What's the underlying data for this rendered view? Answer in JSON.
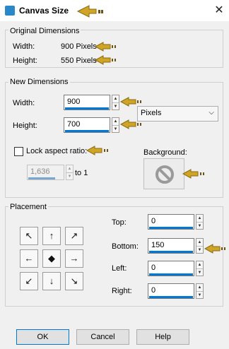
{
  "window": {
    "title": "Canvas Size",
    "close_glyph": "✕"
  },
  "original": {
    "title": "Original Dimensions",
    "width_label": "Width:",
    "width_value": "900 Pixels",
    "height_label": "Height:",
    "height_value": "550 Pixels"
  },
  "new_dimensions": {
    "title": "New Dimensions",
    "width_label": "Width:",
    "width_value": "900",
    "height_label": "Height:",
    "height_value": "700",
    "units_value": "Pixels",
    "lock_label": "Lock aspect ratio:",
    "ratio_value": "1,636",
    "ratio_suffix": "to 1",
    "background_label": "Background:"
  },
  "placement": {
    "title": "Placement",
    "grid_glyphs": [
      "↖",
      "↑",
      "↗",
      "←",
      "◆",
      "→",
      "↙",
      "↓",
      "↘"
    ],
    "top_label": "Top:",
    "top_value": "0",
    "bottom_label": "Bottom:",
    "bottom_value": "150",
    "left_label": "Left:",
    "left_value": "0",
    "right_label": "Right:",
    "right_value": "0"
  },
  "buttons": {
    "ok": "OK",
    "cancel": "Cancel",
    "help": "Help"
  },
  "icons": {
    "app": "canvas-size-icon",
    "background": "no-symbol-icon",
    "annotation": "pointer-arrow-icon"
  },
  "colors": {
    "accent": "#0078d7",
    "annotation": "#d0a526"
  }
}
